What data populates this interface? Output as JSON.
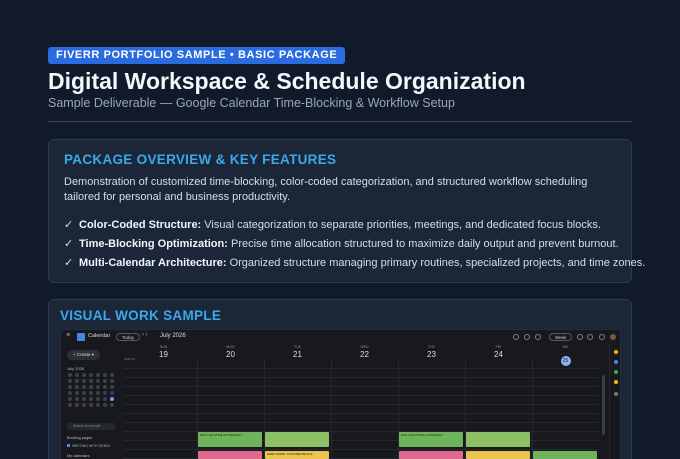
{
  "header": {
    "badge": "FIVERR PORTFOLIO SAMPLE • BASIC PACKAGE",
    "title": "Digital Workspace & Schedule Organization",
    "subtitle": "Sample Deliverable — Google Calendar Time-Blocking & Workflow Setup"
  },
  "overview": {
    "heading": "PACKAGE OVERVIEW & KEY FEATURES",
    "description": "Demonstration of customized time-blocking, color-coded categorization, and structured workflow scheduling tailored for personal and business productivity.",
    "check": "✓",
    "features": [
      {
        "title": "Color-Coded Structure:",
        "text": " Visual categorization to separate priorities, meetings, and dedicated focus blocks."
      },
      {
        "title": "Time-Blocking Optimization:",
        "text": " Precise time allocation structured to maximize daily output and prevent burnout."
      },
      {
        "title": "Multi-Calendar Architecture:",
        "text": " Organized structure managing primary routines, specialized projects, and time zones."
      }
    ]
  },
  "sample": {
    "heading": "VISUAL WORK SAMPLE",
    "calendar": {
      "app_name": "Calendar",
      "today_button": "Today",
      "nav": "‹ ›",
      "month": "July 2026",
      "view_button": "Week",
      "create_button": "Create",
      "mini_month": "July 2026",
      "search_people": "Search for people",
      "booking_label": "Booking pages",
      "booking_item": "MEETING WITH DENNI",
      "my_calendars_label": "My calendars",
      "gmt": "GMT-04",
      "days": [
        {
          "dow": "SUN",
          "num": "19"
        },
        {
          "dow": "MON",
          "num": "20"
        },
        {
          "dow": "TUE",
          "num": "21"
        },
        {
          "dow": "WED",
          "num": "22"
        },
        {
          "dow": "THU",
          "num": "23"
        },
        {
          "dow": "FRI",
          "num": "24"
        },
        {
          "dow": "SAT",
          "num": "25"
        }
      ],
      "events": {
        "mon_green": "DAILY ROUTINE & STRATEGY",
        "tue_green": "",
        "thu_green": "DAILY ROUTINE & STRATEGY",
        "fri_green": "",
        "mon_pink": "",
        "tue_yellow": "DEEP WORK: FOCUSED BLOCK",
        "thu_pink": "",
        "fri_yellow": "",
        "sat_green": ""
      }
    }
  }
}
